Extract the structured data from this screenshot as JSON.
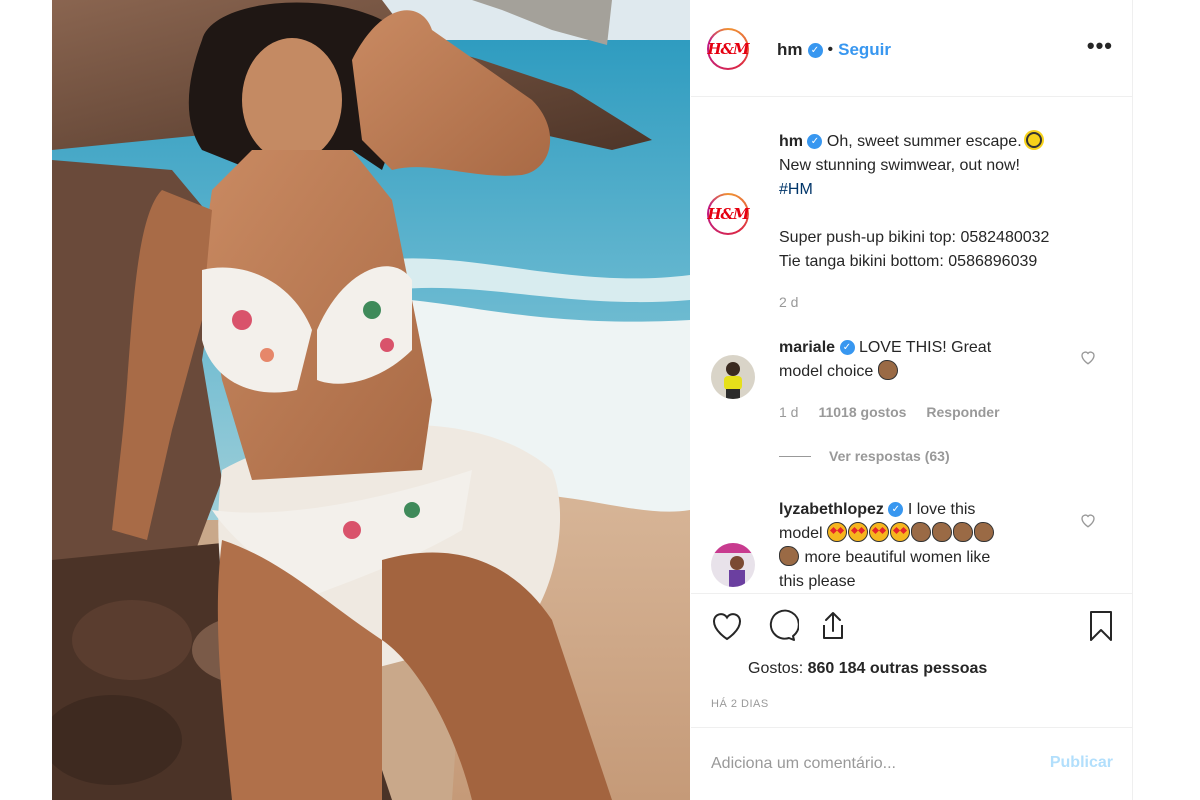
{
  "post": {
    "account": {
      "username": "hm",
      "logo_text": "H&M",
      "follow_label": "Seguir",
      "separator": "•",
      "more_label": "•••"
    },
    "caption": {
      "username": "hm",
      "line1": "Oh, sweet summer escape.",
      "line2": "New stunning swimwear, out now!",
      "hashtag": "#HM",
      "line3": "Super push-up bikini top: 0582480032",
      "line4": "Tie tanga bikini bottom: 0586896039",
      "time": "2 d"
    },
    "comments": [
      {
        "username": "mariale",
        "text_a": "LOVE THIS! Great",
        "text_b": "model choice",
        "time": "1 d",
        "likes": "11018 gostos",
        "reply_label": "Responder",
        "view_replies": "Ver respostas (63)"
      },
      {
        "username": "lyzabethlopez",
        "text_a": "I love this",
        "text_b": "model",
        "text_c": "more beautiful women like",
        "text_d": "this please"
      }
    ],
    "likes": {
      "prefix": "Gostos:",
      "count": "860 184 outras pessoas"
    },
    "date": "HÁ 2 DIAS",
    "add_comment": {
      "placeholder": "Adiciona um comentário...",
      "publish_label": "Publicar"
    },
    "colors": {
      "accent": "#3897f0",
      "publish_disabled": "#b2dffc",
      "meta": "#999999",
      "brand_red": "#e50010"
    },
    "icons": [
      "verified-icon",
      "more-icon",
      "heart-icon",
      "comment-icon",
      "share-icon",
      "bookmark-icon",
      "sun-emoji",
      "heart-eyes-emoji",
      "clap-emoji"
    ]
  }
}
